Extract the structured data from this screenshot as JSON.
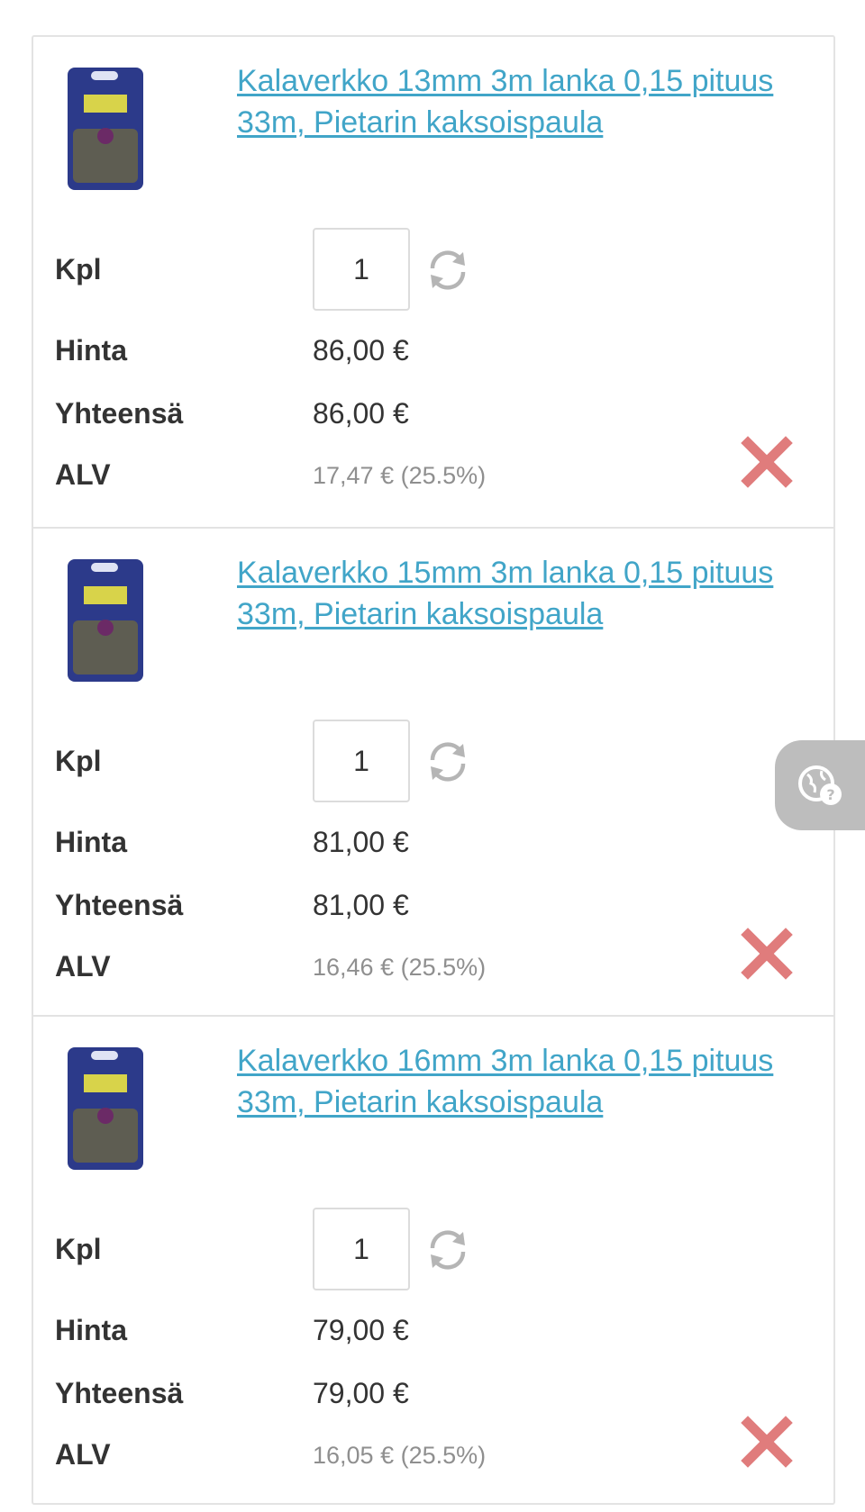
{
  "labels": {
    "quantity": "Kpl",
    "price": "Hinta",
    "total": "Yhteensä",
    "vat": "ALV"
  },
  "items": [
    {
      "title": "Kalaverkko 13mm 3m lanka 0,15 pituus 33m, Pietarin kaksoispaula",
      "quantity": "1",
      "price": "86,00 €",
      "total": "86,00 €",
      "vat": "17,47 € (25.5%)"
    },
    {
      "title": "Kalaverkko 15mm 3m lanka 0,15 pituus 33m, Pietarin kaksoispaula",
      "quantity": "1",
      "price": "81,00 €",
      "total": "81,00 €",
      "vat": "16,46 € (25.5%)"
    },
    {
      "title": "Kalaverkko 16mm 3m lanka 0,15 pituus 33m, Pietarin kaksoispaula",
      "quantity": "1",
      "price": "79,00 €",
      "total": "79,00 €",
      "vat": "16,05 € (25.5%)"
    }
  ],
  "icons": {
    "refresh": "refresh-icon",
    "remove": "remove-x-icon",
    "help": "globe-question-icon"
  },
  "colors": {
    "link": "#41a5c8",
    "remove": "#e07c7c",
    "border": "#e3e3e3",
    "help_tab": "#bdbdbd"
  }
}
